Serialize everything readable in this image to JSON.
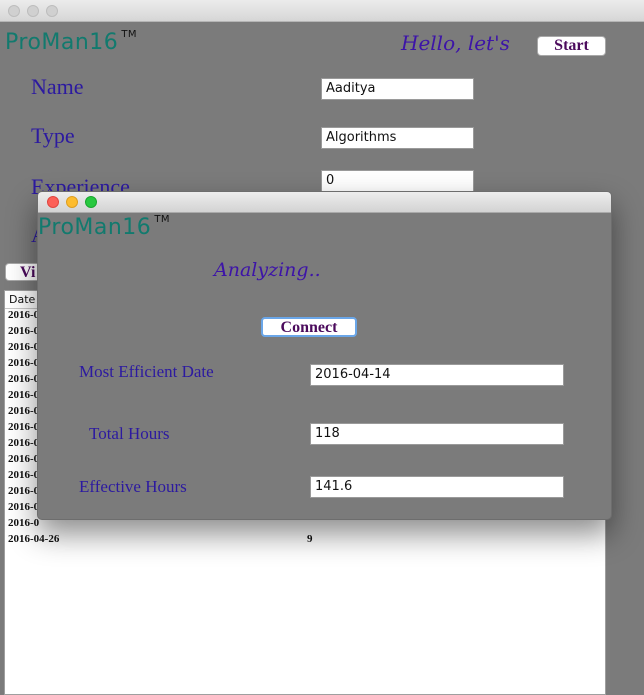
{
  "app": {
    "logo": "ProMan16",
    "trademark": "TM",
    "greeting": "Hello, let's",
    "start_button": "Start"
  },
  "form": {
    "name_label": "Name",
    "name_value": "Aaditya",
    "type_label": "Type",
    "type_value": "Algorithms",
    "experience_label": "Experience",
    "experience_value": "0",
    "partial_label": "A"
  },
  "view_button_partial": "Vi",
  "table": {
    "header": "Date",
    "rows": [
      {
        "date": "2016-0",
        "value": ""
      },
      {
        "date": "2016-0",
        "value": ""
      },
      {
        "date": "2016-0",
        "value": ""
      },
      {
        "date": "2016-0",
        "value": ""
      },
      {
        "date": "2016-0",
        "value": ""
      },
      {
        "date": "2016-0",
        "value": ""
      },
      {
        "date": "2016-0",
        "value": ""
      },
      {
        "date": "2016-0",
        "value": ""
      },
      {
        "date": "2016-0",
        "value": ""
      },
      {
        "date": "2016-0",
        "value": ""
      },
      {
        "date": "2016-0",
        "value": ""
      },
      {
        "date": "2016-0",
        "value": ""
      },
      {
        "date": "2016-0",
        "value": ""
      },
      {
        "date": "2016-0",
        "value": ""
      },
      {
        "date": "2016-04-26",
        "value": "9"
      }
    ]
  },
  "dialog": {
    "logo": "ProMan16",
    "trademark": "TM",
    "status": "Analyzing..",
    "connect_button": "Connect",
    "efficient_date_label": "Most Efficient Date",
    "efficient_date_value": "2016-04-14",
    "total_hours_label": "Total Hours",
    "total_hours_value": "118",
    "effective_hours_label": "Effective Hours",
    "effective_hours_value": "141.6"
  },
  "colors": {
    "background": "#7b7b7b",
    "logo_teal": "#127a6e",
    "label_purple": "#2c1aa0",
    "button_text": "#4b0a5c"
  }
}
